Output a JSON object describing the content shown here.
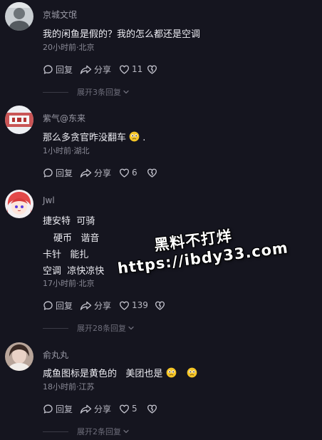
{
  "comments": [
    {
      "username": "京城文氓",
      "lines": [
        "我的闲鱼是假的？我的怎么都还是空调"
      ],
      "meta": "20小时前·北京",
      "reply_label": "回复",
      "share_label": "分享",
      "like_count": "11",
      "expand_label": "展开3条回复"
    },
    {
      "username": "紫气@东来",
      "lines": [
        "那么多贪官昨没翻车",
        "."
      ],
      "meta": "1小时前·湖北",
      "reply_label": "回复",
      "share_label": "分享",
      "like_count": "6"
    },
    {
      "username": "Jwl",
      "lines": [
        "捷安特  可骑",
        "硬币   谐音",
        "卡针   能扎",
        "空调  凉快凉快"
      ],
      "meta": "17小时前·北京",
      "reply_label": "回复",
      "share_label": "分享",
      "like_count": "139",
      "expand_label": "展开28条回复"
    },
    {
      "username": "俞丸丸",
      "lines": [
        "咸鱼图标是黄色的   美团也是"
      ],
      "meta": "18小时前·江苏",
      "reply_label": "回复",
      "share_label": "分享",
      "like_count": "5",
      "expand_label": "展开2条回复"
    }
  ],
  "watermark": {
    "line1": "黑料不打烊",
    "line2": "https://ibdy33.com"
  },
  "colors": {
    "background": "#15151f",
    "text_primary": "#ececf2",
    "text_secondary": "#8a8a96",
    "emoji_yellow": "#f5c526"
  },
  "icons": {
    "reply": "reply-bubble-icon",
    "share": "share-arrow-icon",
    "like": "heart-icon",
    "dislike": "broken-heart-icon",
    "expand": "chevron-down-icon",
    "emoji": "worried-face-emoji"
  }
}
